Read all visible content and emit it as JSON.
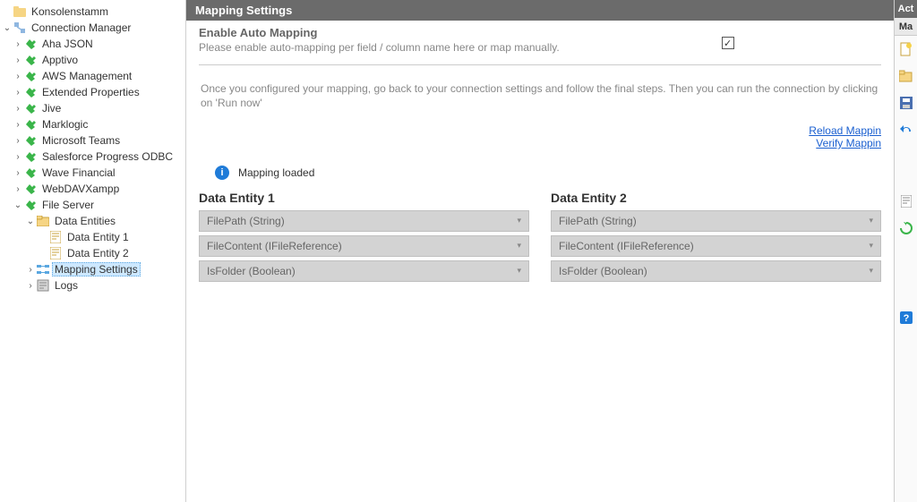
{
  "tree": {
    "root": {
      "label": "Konsolenstamm",
      "icon": "folder"
    },
    "connMgr": {
      "label": "Connection Manager",
      "icon": "connmgr"
    },
    "connections": [
      {
        "label": "Aha JSON"
      },
      {
        "label": "Apptivo"
      },
      {
        "label": "AWS Management"
      },
      {
        "label": "Extended Properties"
      },
      {
        "label": "Jive"
      },
      {
        "label": "Marklogic"
      },
      {
        "label": "Microsoft Teams"
      },
      {
        "label": "Salesforce Progress ODBC"
      },
      {
        "label": "Wave Financial"
      },
      {
        "label": "WebDAVXampp"
      }
    ],
    "fileServer": {
      "label": "File Server"
    },
    "dataEntitiesNode": {
      "label": "Data Entities"
    },
    "dataEntities": [
      {
        "label": "Data Entity 1"
      },
      {
        "label": "Data Entity 2"
      }
    ],
    "mappingSettings": {
      "label": "Mapping Settings"
    },
    "logs": {
      "label": "Logs"
    }
  },
  "main": {
    "title": "Mapping Settings",
    "enable": {
      "title": "Enable Auto Mapping",
      "subtitle": "Please enable auto-mapping per field / column name here or map manually.",
      "checked": true
    },
    "hint": "Once you configured your mapping, go back to your connection settings and follow the final steps. Then you can run the connection by clicking on 'Run now'",
    "links": {
      "reload": "Reload Mappin",
      "verify": "Verify Mappin"
    },
    "status": "Mapping loaded",
    "entity1": {
      "title": "Data Entity 1",
      "fields": [
        "FilePath (String)",
        "FileContent (IFileReference)",
        "IsFolder (Boolean)"
      ]
    },
    "entity2": {
      "title": "Data Entity 2",
      "fields": [
        "FilePath (String)",
        "FileContent (IFileReference)",
        "IsFolder (Boolean)"
      ]
    }
  },
  "actions": {
    "header": "Act",
    "tab": "Ma",
    "icons": [
      "new",
      "open",
      "save",
      "undo"
    ],
    "lowerIcons": [
      "note",
      "refresh"
    ],
    "help": "?"
  },
  "colors": {
    "headerGray": "#6b6b6b",
    "pluginGreen": "#3ab54a",
    "folderYellow": "#f6d584",
    "selectedBlue": "#cde8ff",
    "link": "#1a5fd0"
  }
}
